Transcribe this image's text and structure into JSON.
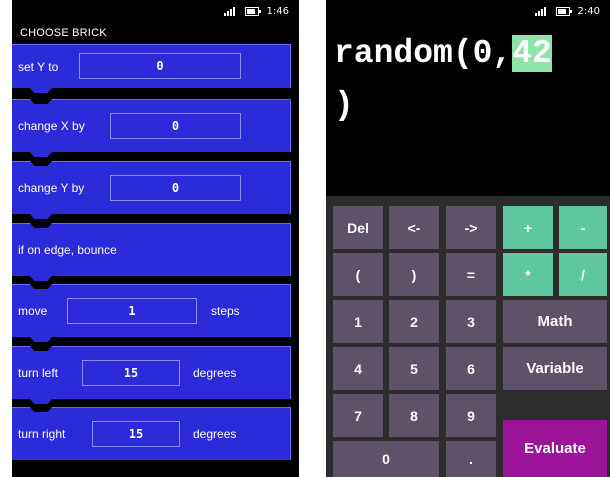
{
  "left": {
    "status": {
      "time": "1:46"
    },
    "title": "CHOOSE BRICK",
    "bricks": [
      {
        "label": "set Y to",
        "value": "0"
      },
      {
        "label": "change X by",
        "value": "0"
      },
      {
        "label": "change Y by",
        "value": "0"
      },
      {
        "label": "if on edge, bounce"
      },
      {
        "label": "move",
        "value": "1",
        "suffix": "steps"
      },
      {
        "label": "turn left",
        "value": "15",
        "suffix": "degrees"
      },
      {
        "label": "turn right",
        "value": "15",
        "suffix": "degrees"
      }
    ]
  },
  "right": {
    "status": {
      "time": "2:40"
    },
    "expression": {
      "before": "random(0,",
      "selected": "42",
      "after": ")"
    },
    "keys": {
      "del": "Del",
      "left": "<-",
      "right": "->",
      "plus": "+",
      "minus": "-",
      "lparen": "(",
      "rparen": ")",
      "equals": "=",
      "times": "*",
      "divide": "/",
      "one": "1",
      "two": "2",
      "three": "3",
      "math": "Math",
      "four": "4",
      "five": "5",
      "six": "6",
      "variable": "Variable",
      "seven": "7",
      "eight": "8",
      "nine": "9",
      "evaluate": "Evaluate",
      "zero": "0",
      "dot": "."
    },
    "colors": {
      "operator": "#5ec7a0",
      "key": "#5f5268",
      "evaluate": "#9b1499",
      "selection": "#8de4a8"
    }
  },
  "colors": {
    "brick": "#2b2bd9"
  }
}
